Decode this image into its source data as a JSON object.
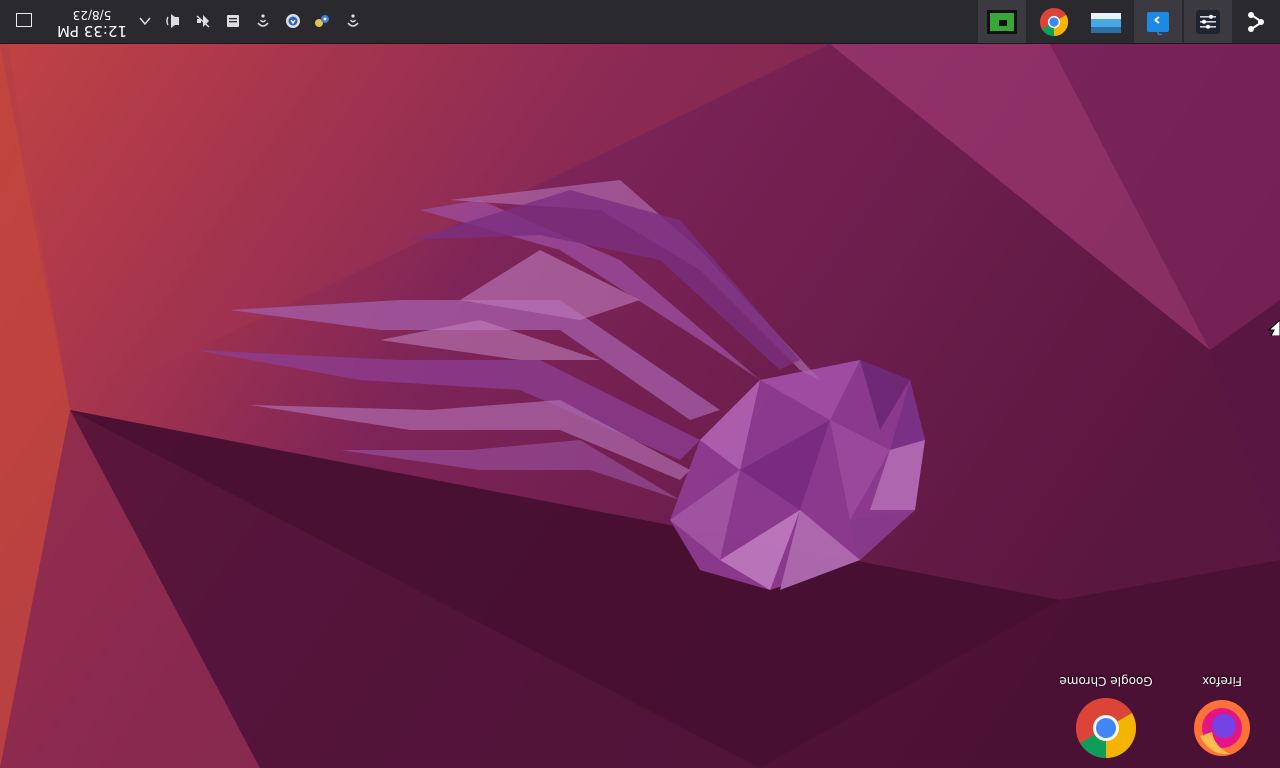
{
  "clock": {
    "time": "12:33 PM",
    "date": "5/8/23"
  },
  "desktop": {
    "icons": [
      {
        "name": "Firefox",
        "icon": "firefox-icon"
      },
      {
        "name": "Google Chrome",
        "icon": "chrome-icon"
      }
    ]
  },
  "taskbar": {
    "apps": [
      {
        "icon": "start-menu-icon"
      },
      {
        "icon": "settings-sliders-icon"
      },
      {
        "icon": "remote-desktop-icon"
      },
      {
        "icon": "display-icon"
      },
      {
        "icon": "chrome-icon"
      },
      {
        "icon": "terminal-icon"
      }
    ],
    "tray": [
      "tray-overflow-chevron-icon",
      "speaker-icon",
      "network-icon",
      "printer-icon",
      "wifi-icon",
      "shield-icon",
      "people-icon",
      "wifi-icon"
    ]
  },
  "colors": {
    "wallpaper_dark": "#4a1235",
    "wallpaper_mid": "#7a2457",
    "wallpaper_orange": "#d0503a",
    "jellyfish": "#a04fa0",
    "taskbar": "#2a2a2e"
  }
}
